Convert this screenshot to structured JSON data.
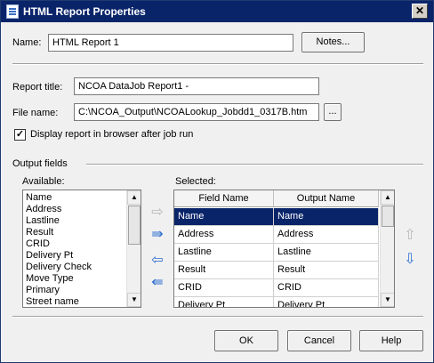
{
  "window": {
    "title": "HTML Report Properties",
    "close_glyph": "✕"
  },
  "name_field": {
    "label": "Name:",
    "value": "HTML Report 1"
  },
  "notes_button": {
    "label": "Notes..."
  },
  "report_title": {
    "label": "Report title:",
    "value": "NCOA DataJob Report1 -"
  },
  "file_name": {
    "label": "File name:",
    "value": "C:\\NCOA_Output\\NCOALookup_Jobdd1_0317B.htm",
    "browse_label": "..."
  },
  "display_checkbox": {
    "label": "Display report in browser after job run",
    "checked": true,
    "check_glyph": "✓"
  },
  "output_fields": {
    "group_label": "Output fields",
    "available_label": "Available:",
    "selected_label": "Selected:",
    "available": [
      "Name",
      "Address",
      "Lastline",
      "Result",
      "CRID",
      "Delivery Pt",
      "Delivery Check",
      "Move Type",
      "Primary",
      "Street name"
    ],
    "columns": [
      "Field Name",
      "Output Name"
    ],
    "selected": [
      {
        "field": "Name",
        "output": "Name"
      },
      {
        "field": "Address",
        "output": "Address"
      },
      {
        "field": "Lastline",
        "output": "Lastline"
      },
      {
        "field": "Result",
        "output": "Result"
      },
      {
        "field": "CRID",
        "output": "CRID"
      },
      {
        "field": "Delivery Pt",
        "output": "Delivery Pt"
      }
    ],
    "selected_row_index": 0
  },
  "icons": {
    "add": "arrow-right-icon",
    "add_all": "double-arrow-right-icon",
    "remove": "arrow-left-icon",
    "remove_all": "double-arrow-left-icon",
    "move_up": "arrow-up-icon",
    "move_down": "arrow-down-icon"
  },
  "colors": {
    "titlebar": "#0a246a",
    "selection": "#0a246a",
    "arrow_blue": "#2f6fd0",
    "arrow_disabled": "#b8b8b8"
  },
  "buttons": {
    "ok": "OK",
    "cancel": "Cancel",
    "help": "Help"
  }
}
